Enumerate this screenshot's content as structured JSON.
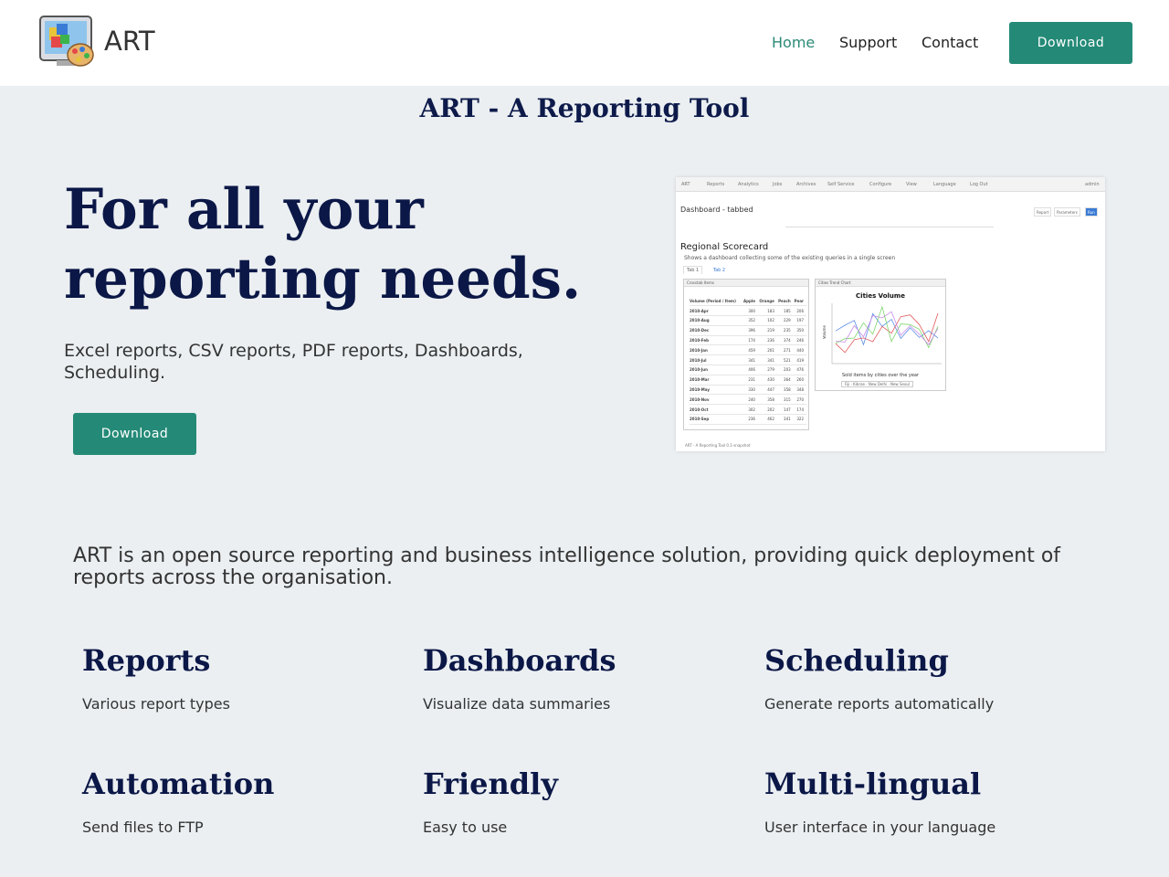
{
  "header": {
    "brand": "ART",
    "nav": [
      {
        "label": "Home",
        "active": true
      },
      {
        "label": "Support",
        "active": false
      },
      {
        "label": "Contact",
        "active": false
      }
    ],
    "download_label": "Download"
  },
  "site_title": "ART - A Reporting Tool",
  "hero": {
    "heading_line1": "For all your",
    "heading_line2": "reporting needs.",
    "subtext": "Excel reports, CSV reports, PDF reports, Dashboards, Scheduling.",
    "download_label": "Download"
  },
  "screenshot": {
    "menu": [
      "ART",
      "Reports",
      "Analytics",
      "Jobs",
      "Archives",
      "Self Service",
      "Configure",
      "View",
      "Language",
      "Log Out",
      "admin"
    ],
    "page_title": "Dashboard - tabbed",
    "buttons": [
      "Report",
      "Parameters",
      "Run"
    ],
    "report_title": "Regional Scorecard",
    "report_desc": "Shows a dashboard collecting some of the existing queries in a single screen",
    "tabs": [
      "Tab 1",
      "Tab 2"
    ],
    "table_panel_title": "Crosstab Items",
    "table_headers": [
      "Volume (Period / Item)",
      "Apple",
      "Orange",
      "Peach",
      "Pear"
    ],
    "table_rows": [
      [
        "2010-Apr",
        "300",
        "183",
        "185",
        "206"
      ],
      [
        "2010-Aug",
        "352",
        "102",
        "229",
        "197"
      ],
      [
        "2010-Dec",
        "396",
        "219",
        "235",
        "350"
      ],
      [
        "2010-Feb",
        "174",
        "236",
        "374",
        "246"
      ],
      [
        "2010-Jan",
        "459",
        "201",
        "271",
        "440"
      ],
      [
        "2010-Jul",
        "341",
        "341",
        "521",
        "419"
      ],
      [
        "2010-Jun",
        "406",
        "279",
        "203",
        "476"
      ],
      [
        "2010-Mar",
        "231",
        "430",
        "364",
        "260"
      ],
      [
        "2010-May",
        "330",
        "447",
        "358",
        "348"
      ],
      [
        "2010-Nov",
        "240",
        "358",
        "315",
        "270"
      ],
      [
        "2010-Oct",
        "302",
        "202",
        "147",
        "174"
      ],
      [
        "2010-Sep",
        "236",
        "462",
        "341",
        "322"
      ]
    ],
    "chart_panel_title": "Cities Trend Chart",
    "chart_title": "Cities Volume",
    "chart_caption": "Sold items by cities over the year",
    "chart_ylabel": "Volume",
    "chart_legend": [
      "Fiji",
      "Kibrae",
      "New Delhi",
      "New Seoul"
    ],
    "series_colors": [
      "#5b8ee6",
      "#e35b5b",
      "#7cd66b",
      "#c98be8"
    ],
    "footer": "ART - A Reporting Tool 0.1-snapshot"
  },
  "about": "ART is an open source reporting and business intelligence solution, providing quick deployment of reports across the organisation.",
  "features": [
    {
      "title": "Reports",
      "desc": "Various report types"
    },
    {
      "title": "Dashboards",
      "desc": "Visualize data summaries"
    },
    {
      "title": "Scheduling",
      "desc": "Generate reports automatically"
    },
    {
      "title": "Automation",
      "desc": "Send files to FTP"
    },
    {
      "title": "Friendly",
      "desc": "Easy to use"
    },
    {
      "title": "Multi-lingual",
      "desc": "User interface in your language"
    }
  ]
}
